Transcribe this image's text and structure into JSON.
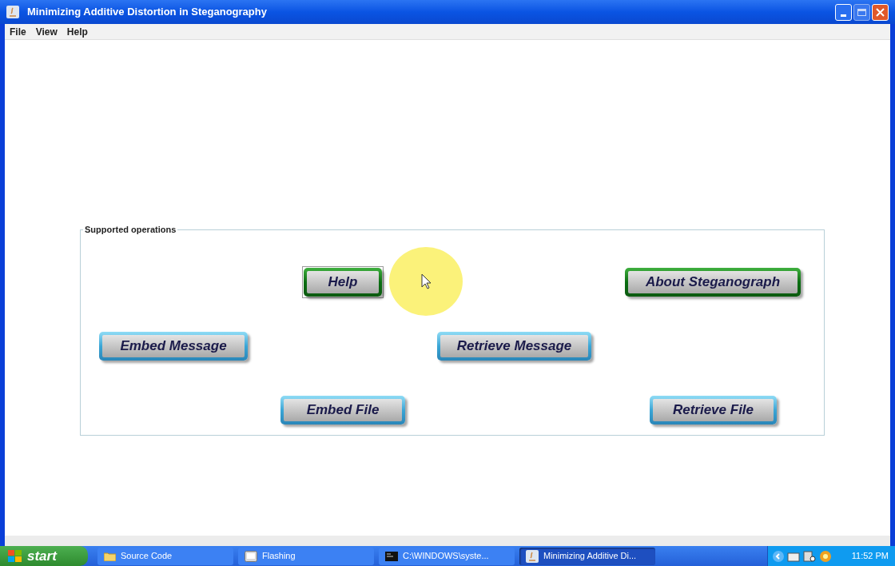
{
  "window": {
    "title": "Minimizing Additive Distortion in Steganography"
  },
  "menu": [
    "File",
    "View",
    "Help"
  ],
  "panel": {
    "title": "Supported operations",
    "rows": [
      [
        {
          "label": "Help",
          "kind": "green",
          "focused": true
        },
        {
          "label": "About Steganograph",
          "kind": "green",
          "focused": false
        }
      ],
      [
        {
          "label": "Embed Message",
          "kind": "blue",
          "focused": false
        },
        {
          "label": "Retrieve Message",
          "kind": "blue",
          "focused": false
        }
      ],
      [
        {
          "label": "Embed File",
          "kind": "blue",
          "focused": false
        },
        {
          "label": "Retrieve File",
          "kind": "blue",
          "focused": false
        }
      ]
    ]
  },
  "taskbar": {
    "start": "start",
    "items": [
      {
        "label": "Source Code",
        "kind": "folder",
        "selected": false
      },
      {
        "label": "Flashing",
        "kind": "app",
        "selected": false
      },
      {
        "label": "C:\\WINDOWS\\syste...",
        "kind": "console",
        "selected": false
      },
      {
        "label": "Minimizing Additive Di...",
        "kind": "java",
        "selected": true
      }
    ],
    "clock": "11:52 PM"
  }
}
